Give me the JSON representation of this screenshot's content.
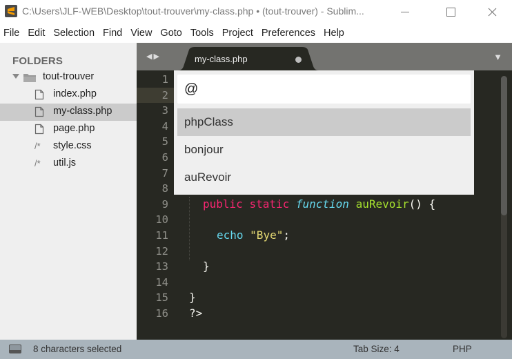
{
  "window": {
    "title": "C:\\Users\\JLF-WEB\\Desktop\\tout-trouver\\my-class.php • (tout-trouver) - Sublim...",
    "app_icon": "sublime-text-icon",
    "controls": {
      "minimize": "—",
      "maximize": "☐",
      "close": "✕"
    }
  },
  "menu": [
    "File",
    "Edit",
    "Selection",
    "Find",
    "View",
    "Goto",
    "Tools",
    "Project",
    "Preferences",
    "Help"
  ],
  "sidebar": {
    "heading": "FOLDERS",
    "folder": {
      "name": "tout-trouver",
      "expanded": true
    },
    "files": [
      {
        "name": "index.php",
        "icon": "file-icon",
        "selected": false
      },
      {
        "name": "my-class.php",
        "icon": "file-icon",
        "selected": true
      },
      {
        "name": "page.php",
        "icon": "file-icon",
        "selected": false
      },
      {
        "name": "style.css",
        "icon": "comment-file-icon",
        "icon_glyph": "/*",
        "selected": false
      },
      {
        "name": "util.js",
        "icon": "comment-file-icon",
        "icon_glyph": "/*",
        "selected": false
      }
    ]
  },
  "tabs": {
    "nav_arrows": "◀ ▶",
    "active": {
      "label": "my-class.php",
      "modified": true
    },
    "menu_arrow": "▼"
  },
  "editor": {
    "line_numbers": [
      "1",
      "2",
      "3",
      "4",
      "5",
      "6",
      "7",
      "8",
      "9",
      "10",
      "11",
      "12",
      "13",
      "14",
      "15",
      "16"
    ],
    "highlighted_line": 2,
    "visible_code": {
      "line9": {
        "kw1": "public",
        "kw2": "static",
        "fn_kw": "function",
        "fn_name": "auRevoir",
        "rest": "() {"
      },
      "line11": {
        "builtin": "echo",
        "str": "\"Bye\"",
        "rest": ";"
      },
      "line13": "}",
      "line15": "}",
      "line16": "?>"
    },
    "line8_partial": "}"
  },
  "symbol_popup": {
    "input_value": "@",
    "items": [
      {
        "label": "phpClass",
        "selected": true
      },
      {
        "label": "bonjour",
        "selected": false
      },
      {
        "label": "auRevoir",
        "selected": false
      }
    ]
  },
  "statusbar": {
    "selection": "8 characters selected",
    "tab_size": "Tab Size: 4",
    "syntax": "PHP"
  },
  "colors": {
    "editor_bg": "#272822",
    "keyword": "#f92672",
    "function_name": "#a6e22e",
    "builtin": "#66d9ef",
    "string": "#e6db74",
    "statusbar_bg": "#a9b4bc",
    "accent_icon": "#f59b00"
  }
}
